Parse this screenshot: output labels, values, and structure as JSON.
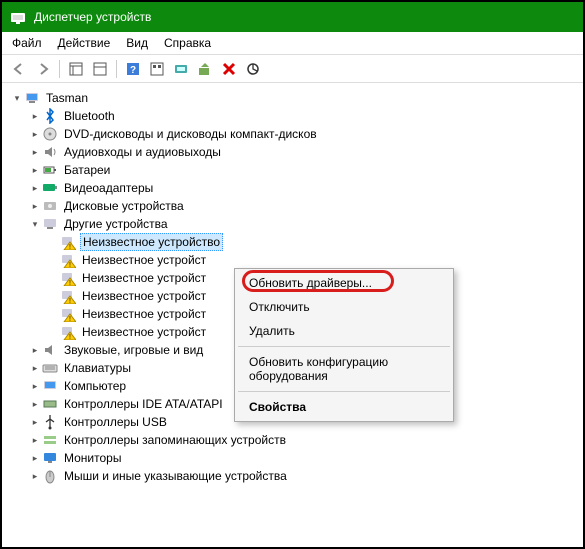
{
  "titlebar": {
    "title": "Диспетчер устройств"
  },
  "menubar": {
    "file": "Файл",
    "action": "Действие",
    "view": "Вид",
    "help": "Справка"
  },
  "tree": {
    "root": "Tasman",
    "bluetooth": "Bluetooth",
    "dvd": "DVD-дисководы и дисководы компакт-дисков",
    "audio": "Аудиовходы и аудиовыходы",
    "battery": "Батареи",
    "video": "Видеоадаптеры",
    "disk": "Дисковые устройства",
    "other": "Другие устройства",
    "other_children": [
      "Неизвестное устройство",
      "Неизвестное устройст",
      "Неизвестное устройст",
      "Неизвестное устройст",
      "Неизвестное устройст",
      "Неизвестное устройст"
    ],
    "sound": "Звуковые, игровые и вид",
    "keyboard": "Клавиатуры",
    "computer": "Компьютер",
    "ide": "Контроллеры IDE ATA/ATAPI",
    "usb": "Контроллеры USB",
    "storage": "Контроллеры запоминающих устройств",
    "monitors": "Мониторы",
    "mice": "Мыши и иные указывающие устройства"
  },
  "context_menu": {
    "update": "Обновить драйверы...",
    "disable": "Отключить",
    "delete": "Удалить",
    "scan": "Обновить конфигурацию оборудования",
    "properties": "Свойства"
  }
}
